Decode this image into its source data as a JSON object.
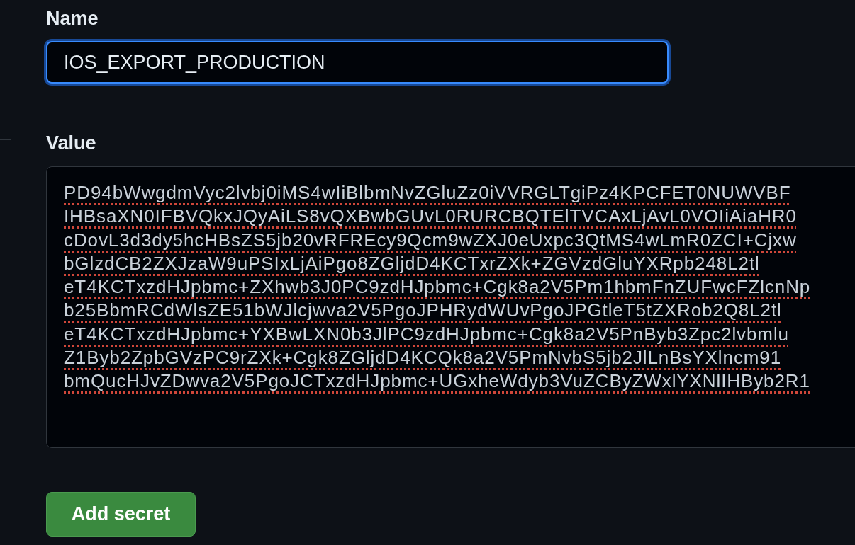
{
  "fields": [
    {
      "kind": "input",
      "label": "Name",
      "value": "IOS_EXPORT_PRODUCTION",
      "focused": true
    },
    {
      "kind": "textarea",
      "label": "Value",
      "focused": false,
      "misspelled": true,
      "lines": [
        "PD94bWwgdmVyc2lvbj0iMS4wIiBlbmNvZGluZz0iVVRGLTgiPz4KPCFET0NUWVBF",
        "IHBsaXN0IFBVQkxJQyAiLS8vQXBwbGUvL0RURCBQTElTVCAxLjAvL0VOIiAiaHR0",
        "cDovL3d3dy5hcHBsZS5jb20vRFREcy9Qcm9wZXJ0eUxpc3QtMS4wLmR0ZCI+Cjxw",
        "bGlzdCB2ZXJzaW9uPSIxLjAiPgo8ZGljdD4KCTxrZXk+ZGVzdGluYXRpb248L2tl",
        "eT4KCTxzdHJpbmc+ZXhwb3J0PC9zdHJpbmc+Cgk8a2V5Pm1hbmFnZUFwcFZlcnNp",
        "b25BbmRCdWlsZE51bWJlcjwva2V5PgoJPHRydWUvPgoJPGtleT5tZXRob2Q8L2tl",
        "eT4KCTxzdHJpbmc+YXBwLXN0b3JlPC9zdHJpbmc+Cgk8a2V5PnByb3Zpc2lvbmlu",
        "Z1Byb2ZpbGVzPC9rZXk+Cgk8ZGljdD4KCQk8a2V5PmNvbS5jb2JlLnBsYXlncm91",
        "bmQucHJvZDwva2V5PgoJCTxzdHJpbmc+UGxheWdyb3VuZCByZWxlYXNlIHByb2R1"
      ]
    }
  ],
  "submit_button": "Add secret"
}
